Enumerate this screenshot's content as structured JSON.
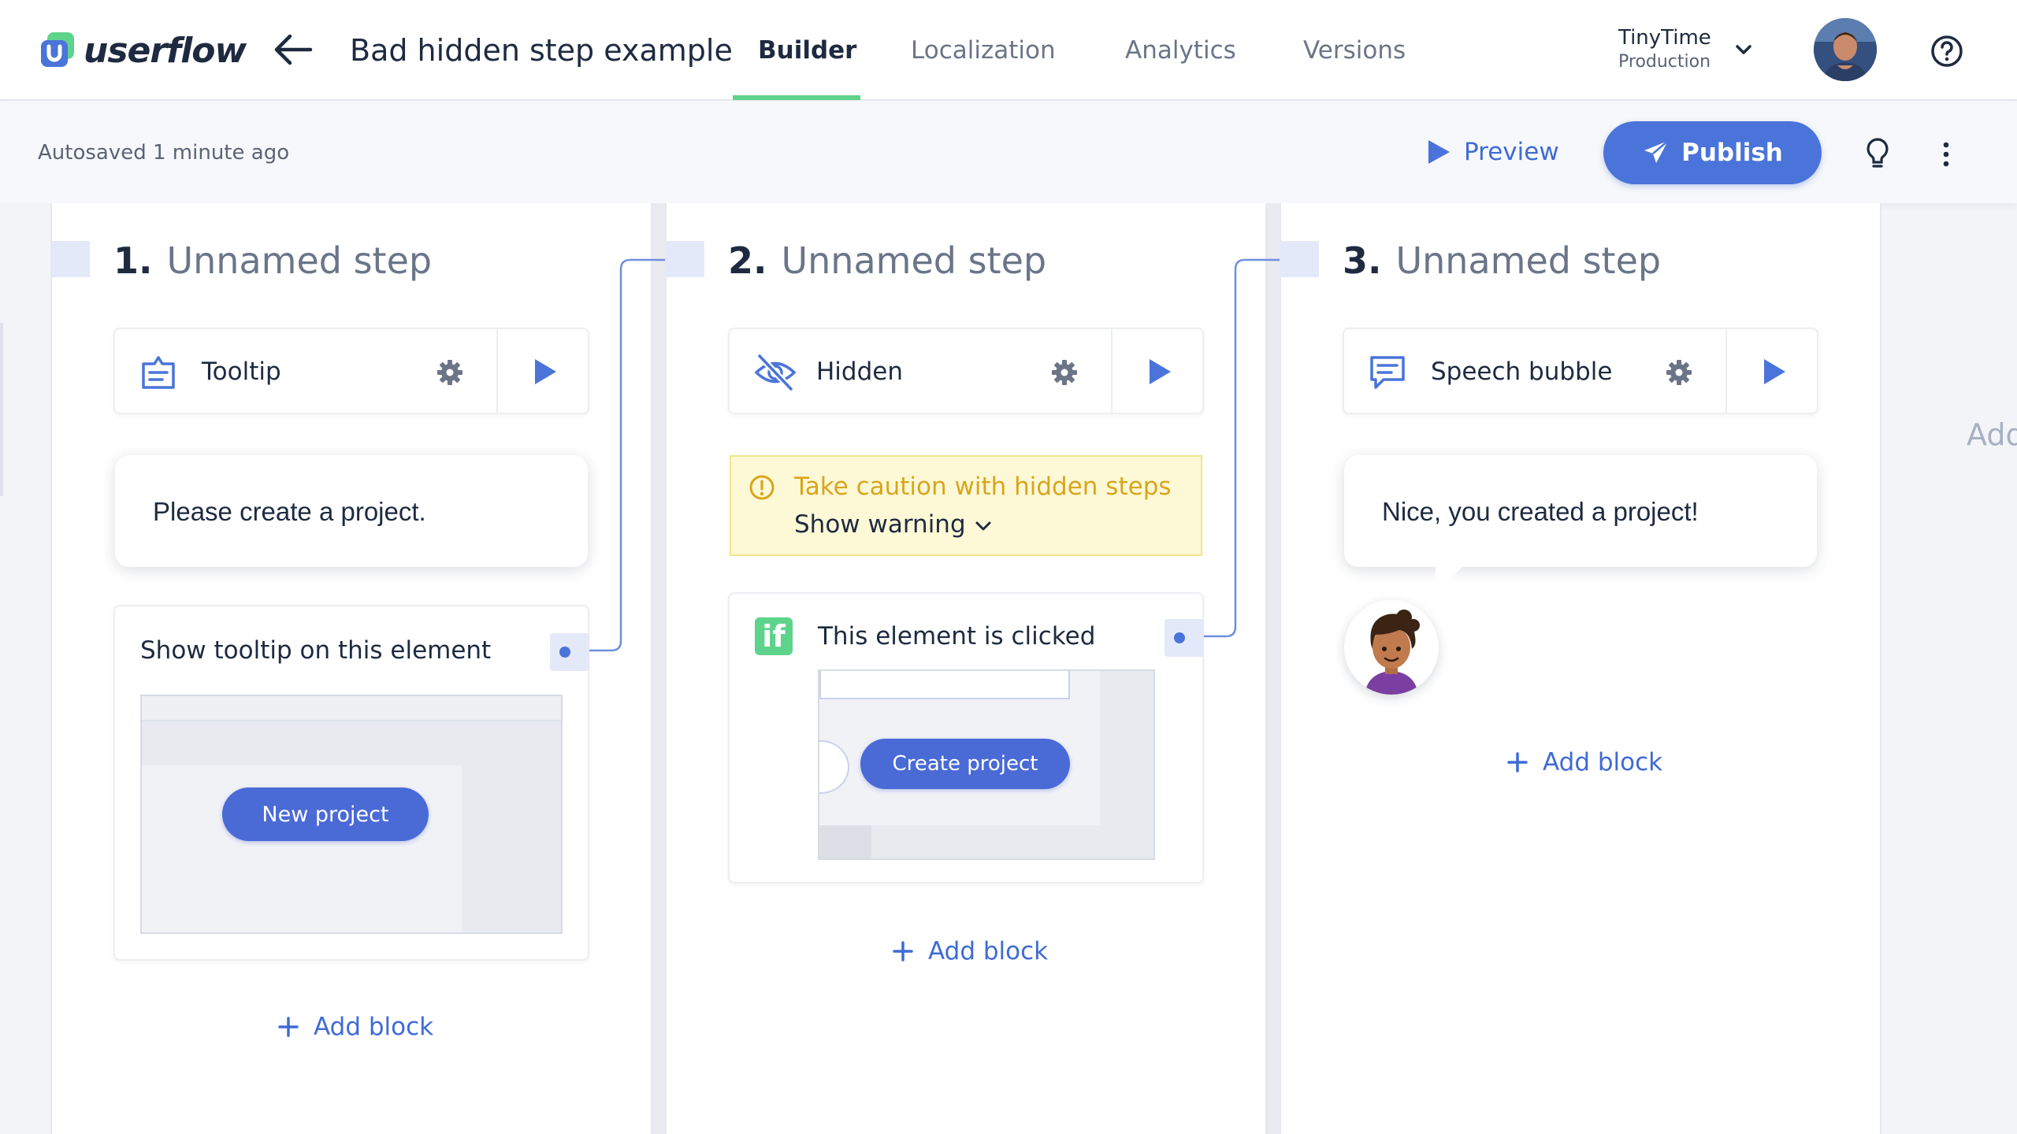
{
  "app": {
    "logo_text": "userflow"
  },
  "header": {
    "flow_title": "Bad hidden step example",
    "tabs": [
      {
        "label": "Builder",
        "active": true
      },
      {
        "label": "Localization"
      },
      {
        "label": "Analytics"
      },
      {
        "label": "Versions"
      }
    ],
    "environment": {
      "name": "TinyTime",
      "sub": "Production"
    }
  },
  "toolbar": {
    "autosave": "Autosaved 1 minute ago",
    "preview_label": "Preview",
    "publish_label": "Publish"
  },
  "steps": [
    {
      "number": "1.",
      "title": "Unnamed step",
      "block": {
        "type_label": "Tooltip",
        "icon": "tooltip-icon"
      },
      "content": "Please create a project.",
      "trigger": {
        "label": "Show tooltip on this element",
        "button_label": "New project"
      },
      "add_block": "Add block"
    },
    {
      "number": "2.",
      "title": "Unnamed step",
      "block": {
        "type_label": "Hidden",
        "icon": "eye-slash-icon"
      },
      "warning": {
        "title": "Take caution with hidden steps",
        "toggle": "Show warning"
      },
      "trigger": {
        "badge": "if",
        "label": "This element is clicked",
        "button_label": "Create project"
      },
      "add_block": "Add block"
    },
    {
      "number": "3.",
      "title": "Unnamed step",
      "block": {
        "type_label": "Speech bubble",
        "icon": "speech-bubble-icon"
      },
      "content": "Nice, you created a project!",
      "add_block": "Add block"
    }
  ],
  "ghost_column_text": "Add",
  "colors": {
    "accent": "#4a74d9",
    "builder_underline": "#5ed38b",
    "warning_bg": "#fdf9d6",
    "warning_text": "#d9a51c"
  }
}
